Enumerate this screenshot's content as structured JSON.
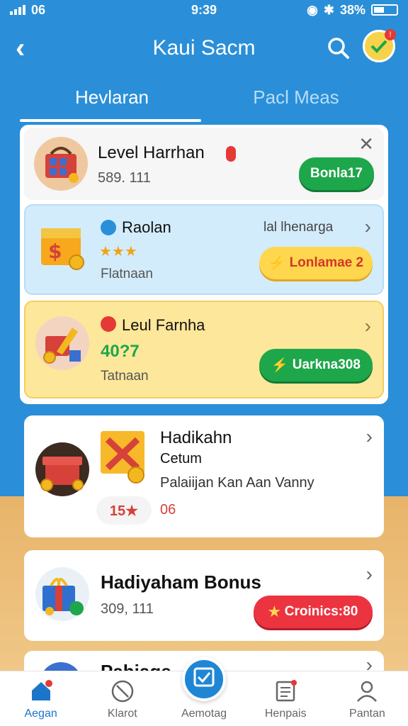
{
  "status": {
    "left": "06",
    "time": "9:39",
    "battery": "38%"
  },
  "header": {
    "title": "Kaui Sacm"
  },
  "tabs": [
    {
      "label": "Hevlaran",
      "active": true
    },
    {
      "label": "Pacl Meas",
      "active": false
    }
  ],
  "cards": [
    {
      "title": "Level Harrhan",
      "subtitle": "589. 111",
      "button": "Bonla17"
    },
    {
      "title": "Raolan",
      "right_label": "lal lhenarga",
      "stars": "★★★",
      "subtitle": "Flatnaan",
      "button": "Lonlamae 2"
    },
    {
      "title": "Leul Farnha",
      "value": "40?7",
      "subtitle": "Tatnaan",
      "button": "Uarkna308"
    }
  ],
  "big_cards": [
    {
      "title": "Hadikahn",
      "subtitle": "Cetum",
      "desc": "Palaiijan Kan Aan Vanny",
      "badge": "15★",
      "badge_num": "06"
    },
    {
      "title": "Hadiyaham Bonus",
      "subtitle": "309, 111",
      "button": "Croinics:80"
    },
    {
      "title": "Pahiage"
    }
  ],
  "nav": [
    {
      "label": "Aegan",
      "icon": "home-icon",
      "active": true
    },
    {
      "label": "Klarot",
      "icon": "compass-icon",
      "active": false
    },
    {
      "label": "Aemotag",
      "icon": "check-icon",
      "active": false
    },
    {
      "label": "Henpais",
      "icon": "document-icon",
      "active": false
    },
    {
      "label": "Pantan",
      "icon": "user-icon",
      "active": false
    }
  ],
  "colors": {
    "primary": "#2a8fd8",
    "green": "#1ea64a",
    "yellow": "#ffd74e",
    "red": "#ec3340"
  }
}
